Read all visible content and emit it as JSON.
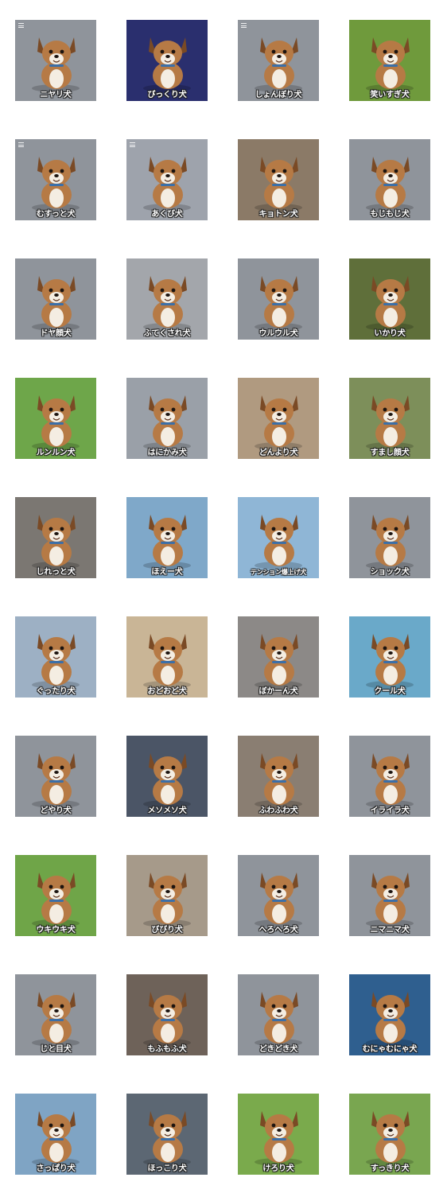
{
  "stickers": [
    {
      "caption": "ニヤリ犬",
      "bg": "#8f949b",
      "menu": true
    },
    {
      "caption": "びっくり犬",
      "bg": "#2a2f6e",
      "menu": false
    },
    {
      "caption": "しょんぼり犬",
      "bg": "#8f949b",
      "menu": true
    },
    {
      "caption": "笑いすぎ犬",
      "bg": "#6f9a3c",
      "menu": false
    },
    {
      "caption": "むすっと犬",
      "bg": "#8f949b",
      "menu": true
    },
    {
      "caption": "あくび犬",
      "bg": "#9ea3ac",
      "menu": true
    },
    {
      "caption": "キョトン犬",
      "bg": "#8b7a67",
      "menu": false
    },
    {
      "caption": "もじもじ犬",
      "bg": "#8f949b",
      "menu": false
    },
    {
      "caption": "ドヤ顔犬",
      "bg": "#8f949b",
      "menu": false
    },
    {
      "caption": "ふてくされ犬",
      "bg": "#a3a6ab",
      "menu": false
    },
    {
      "caption": "ウルウル犬",
      "bg": "#8f949b",
      "menu": false
    },
    {
      "caption": "いかり犬",
      "bg": "#5f6f3a",
      "menu": false
    },
    {
      "caption": "ルンルン犬",
      "bg": "#6ea64a",
      "menu": false
    },
    {
      "caption": "はにかみ犬",
      "bg": "#9aa0a8",
      "menu": false
    },
    {
      "caption": "どんより犬",
      "bg": "#b09a80",
      "menu": false
    },
    {
      "caption": "すまし顔犬",
      "bg": "#7d8f5a",
      "menu": false
    },
    {
      "caption": "しれっと犬",
      "bg": "#7b7772",
      "menu": false
    },
    {
      "caption": "ほえー犬",
      "bg": "#7fa8c9",
      "menu": false
    },
    {
      "caption": "テンション爆上げ犬",
      "bg": "#8fb6d6",
      "menu": false
    },
    {
      "caption": "ショック犬",
      "bg": "#8f949b",
      "menu": false
    },
    {
      "caption": "ぐったり犬",
      "bg": "#9db0c4",
      "menu": false
    },
    {
      "caption": "おどおど犬",
      "bg": "#c9b596",
      "menu": false
    },
    {
      "caption": "ぼかーん犬",
      "bg": "#8c8987",
      "menu": false
    },
    {
      "caption": "クール犬",
      "bg": "#6aa9c9",
      "menu": false
    },
    {
      "caption": "どやり犬",
      "bg": "#8f949b",
      "menu": false
    },
    {
      "caption": "メソメソ犬",
      "bg": "#4b5566",
      "menu": false
    },
    {
      "caption": "ふわふわ犬",
      "bg": "#8a7e72",
      "menu": false
    },
    {
      "caption": "イライラ犬",
      "bg": "#8f949b",
      "menu": false
    },
    {
      "caption": "ウキウキ犬",
      "bg": "#6fa548",
      "menu": false
    },
    {
      "caption": "びびり犬",
      "bg": "#a69a8a",
      "menu": false
    },
    {
      "caption": "へろへろ犬",
      "bg": "#8f949b",
      "menu": false
    },
    {
      "caption": "ニマニマ犬",
      "bg": "#8f949b",
      "menu": false
    },
    {
      "caption": "じと目犬",
      "bg": "#8f949b",
      "menu": false
    },
    {
      "caption": "もふもふ犬",
      "bg": "#6e6259",
      "menu": false
    },
    {
      "caption": "どきどき犬",
      "bg": "#8f949b",
      "menu": false
    },
    {
      "caption": "むにゃむにゃ犬",
      "bg": "#2f5f8f",
      "menu": false
    },
    {
      "caption": "さっぱり犬",
      "bg": "#7fa4c4",
      "menu": false
    },
    {
      "caption": "ほっこり犬",
      "bg": "#5c6773",
      "menu": false
    },
    {
      "caption": "けろり犬",
      "bg": "#7aaa4c",
      "menu": false
    },
    {
      "caption": "すっきり犬",
      "bg": "#79a650",
      "menu": false
    }
  ]
}
